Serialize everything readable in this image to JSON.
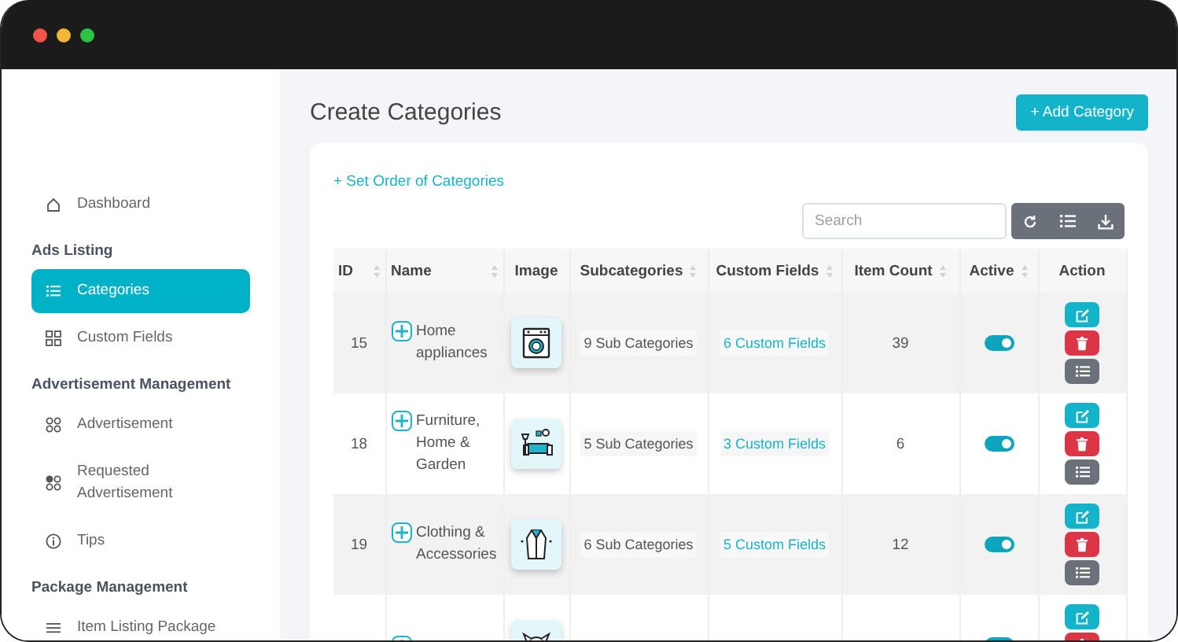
{
  "sidebar": {
    "items": [
      {
        "kind": "link",
        "label": "Dashboard",
        "selected": false
      },
      {
        "kind": "heading",
        "label": "Ads Listing"
      },
      {
        "kind": "link",
        "label": "Categories",
        "selected": true
      },
      {
        "kind": "link",
        "label": "Custom Fields",
        "selected": false
      },
      {
        "kind": "heading",
        "label": "Advertisement Management"
      },
      {
        "kind": "link",
        "label": "Advertisement",
        "selected": false
      },
      {
        "kind": "link",
        "label": "Requested Advertisement",
        "selected": false
      },
      {
        "kind": "link",
        "label": "Tips",
        "selected": false
      },
      {
        "kind": "heading",
        "label": "Package Management"
      },
      {
        "kind": "link",
        "label": "Item Listing Package",
        "selected": false
      }
    ]
  },
  "page": {
    "title": "Create Categories",
    "add_button": "+ Add Category",
    "order_link": "+ Set Order of Categories",
    "search": {
      "placeholder": "Search"
    }
  },
  "table": {
    "columns": [
      {
        "label": "ID",
        "sortable": true
      },
      {
        "label": "Name",
        "sortable": true
      },
      {
        "label": "Image",
        "sortable": false
      },
      {
        "label": "Subcategories",
        "sortable": true
      },
      {
        "label": "Custom Fields",
        "sortable": true
      },
      {
        "label": "Item Count",
        "sortable": true
      },
      {
        "label": "Active",
        "sortable": true
      },
      {
        "label": "Action",
        "sortable": false
      }
    ],
    "rows": [
      {
        "id": "15",
        "name": "Home appliances",
        "subcategories": "9 Sub Categories",
        "custom_fields": "6 Custom Fields",
        "item_count": "39",
        "active": true
      },
      {
        "id": "18",
        "name": "Furniture, Home & Garden",
        "subcategories": "5 Sub Categories",
        "custom_fields": "3 Custom Fields",
        "item_count": "6",
        "active": true
      },
      {
        "id": "19",
        "name": "Clothing & Accessories",
        "subcategories": "6 Sub Categories",
        "custom_fields": "5 Custom Fields",
        "item_count": "12",
        "active": true
      },
      {
        "active": true
      }
    ]
  }
}
